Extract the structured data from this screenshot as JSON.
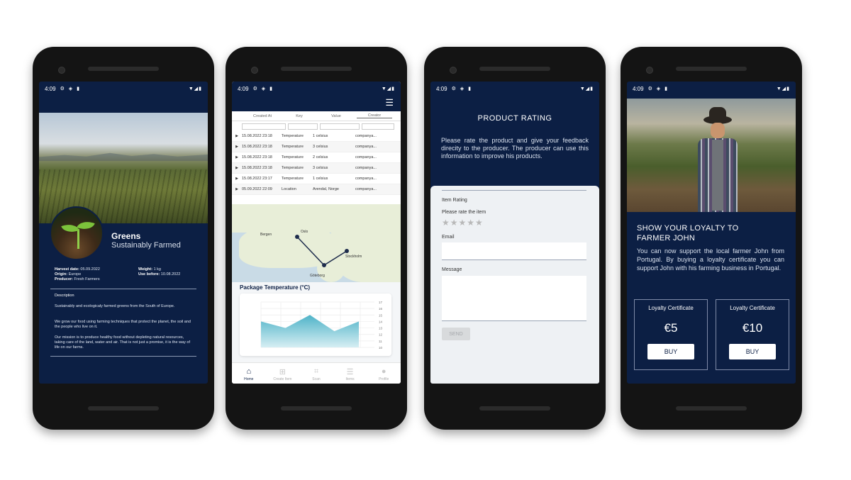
{
  "phone1": {
    "status_time": "4:09",
    "title": "Greens",
    "subtitle": "Sustainably Farmed",
    "details": [
      {
        "label": "Harvest date:",
        "value": "05.09.2022"
      },
      {
        "label": "Origin:",
        "value": "Europe"
      },
      {
        "label": "Producer:",
        "value": "Fresh Farmers"
      }
    ],
    "details_right": [
      {
        "label": "Weight:",
        "value": "1 kg"
      },
      {
        "label": "Use before:",
        "value": "10.08.2022"
      }
    ],
    "description_heading": "Description",
    "description": [
      "Sustainably and ecologicaly farmed greens from the South of Europe.",
      "We grow our food using farming techniques that protect the planet, the soil and the people who live on it.",
      "Our mission is to produce healthy food without depleting natural resources, taking care of the land, water and air. That is not just a promise, it is the way of life on our farms."
    ]
  },
  "phone2": {
    "status_time": "4:09",
    "table": {
      "columns": [
        "Created At",
        "Key",
        "Value",
        "Creator"
      ],
      "rows": [
        {
          "created": "15.08.2022 23:18",
          "key": "Temperature",
          "value": "1 celsius",
          "creator": "companya..."
        },
        {
          "created": "15.08.2022 23:18",
          "key": "Temperature",
          "value": "3 celsius",
          "creator": "companya..."
        },
        {
          "created": "15.08.2022 23:18",
          "key": "Temperature",
          "value": "2 celsius",
          "creator": "companya..."
        },
        {
          "created": "15.08.2022 23:18",
          "key": "Temperature",
          "value": "3 celsius",
          "creator": "companya..."
        },
        {
          "created": "15.08.2022 23:17",
          "key": "Temperature",
          "value": "1 celsius",
          "creator": "companya..."
        },
        {
          "created": "05.09.2022 22:09",
          "key": "Location",
          "value": "Arendal, Norge",
          "creator": "companya..."
        }
      ]
    },
    "map_labels": {
      "oslo": "Oslo",
      "bergen": "Bergen",
      "stockholm": "Stockholm",
      "goteborg": "Göteborg"
    },
    "chart_title": "Package Temperature (°C)",
    "nav": [
      {
        "label": "Home",
        "icon": "home-icon"
      },
      {
        "label": "Create Item",
        "icon": "add-box-icon"
      },
      {
        "label": "Scan",
        "icon": "qr-scan-icon"
      },
      {
        "label": "Items",
        "icon": "list-icon"
      },
      {
        "label": "Profile",
        "icon": "person-icon"
      }
    ]
  },
  "chart_data": {
    "type": "area",
    "title": "Package Temperature (°C)",
    "x": [
      1,
      2,
      3,
      4,
      5
    ],
    "values": [
      14,
      13,
      15,
      12.5,
      14
    ],
    "yticks": [
      17,
      16,
      15,
      14,
      13,
      12,
      11,
      10
    ],
    "ylim": [
      10,
      17
    ],
    "colors": {
      "fill_top": "#4fb3c8",
      "fill_bottom": "#d6eef3"
    }
  },
  "phone3": {
    "status_time": "4:09",
    "title": "PRODUCT RATING",
    "intro": "Please rate the product and give your feedback direcity to the producer. The producer can use this information to improve his products.",
    "item_rating": "Item Rating",
    "rate_prompt": "Please rate the item",
    "stars": "★★★★★",
    "email_label": "Email",
    "message_label": "Message",
    "send_label": "SEND"
  },
  "phone4": {
    "status_time": "4:09",
    "title_line1": "SHOW YOUR LOYALTY TO",
    "title_line2": "FARMER JOHN",
    "text": "You can now support the local farmer John from Portugal. By buying a loyalty certificate you can support John with his farming business in Portugal.",
    "certificates": [
      {
        "title": "Loyalty Certificate",
        "price": "€5",
        "button": "BUY"
      },
      {
        "title": "Loyalty Certificate",
        "price": "€10",
        "button": "BUY"
      }
    ]
  },
  "colors": {
    "navy": "#0c1f44",
    "accent": "#4fb3c8"
  }
}
